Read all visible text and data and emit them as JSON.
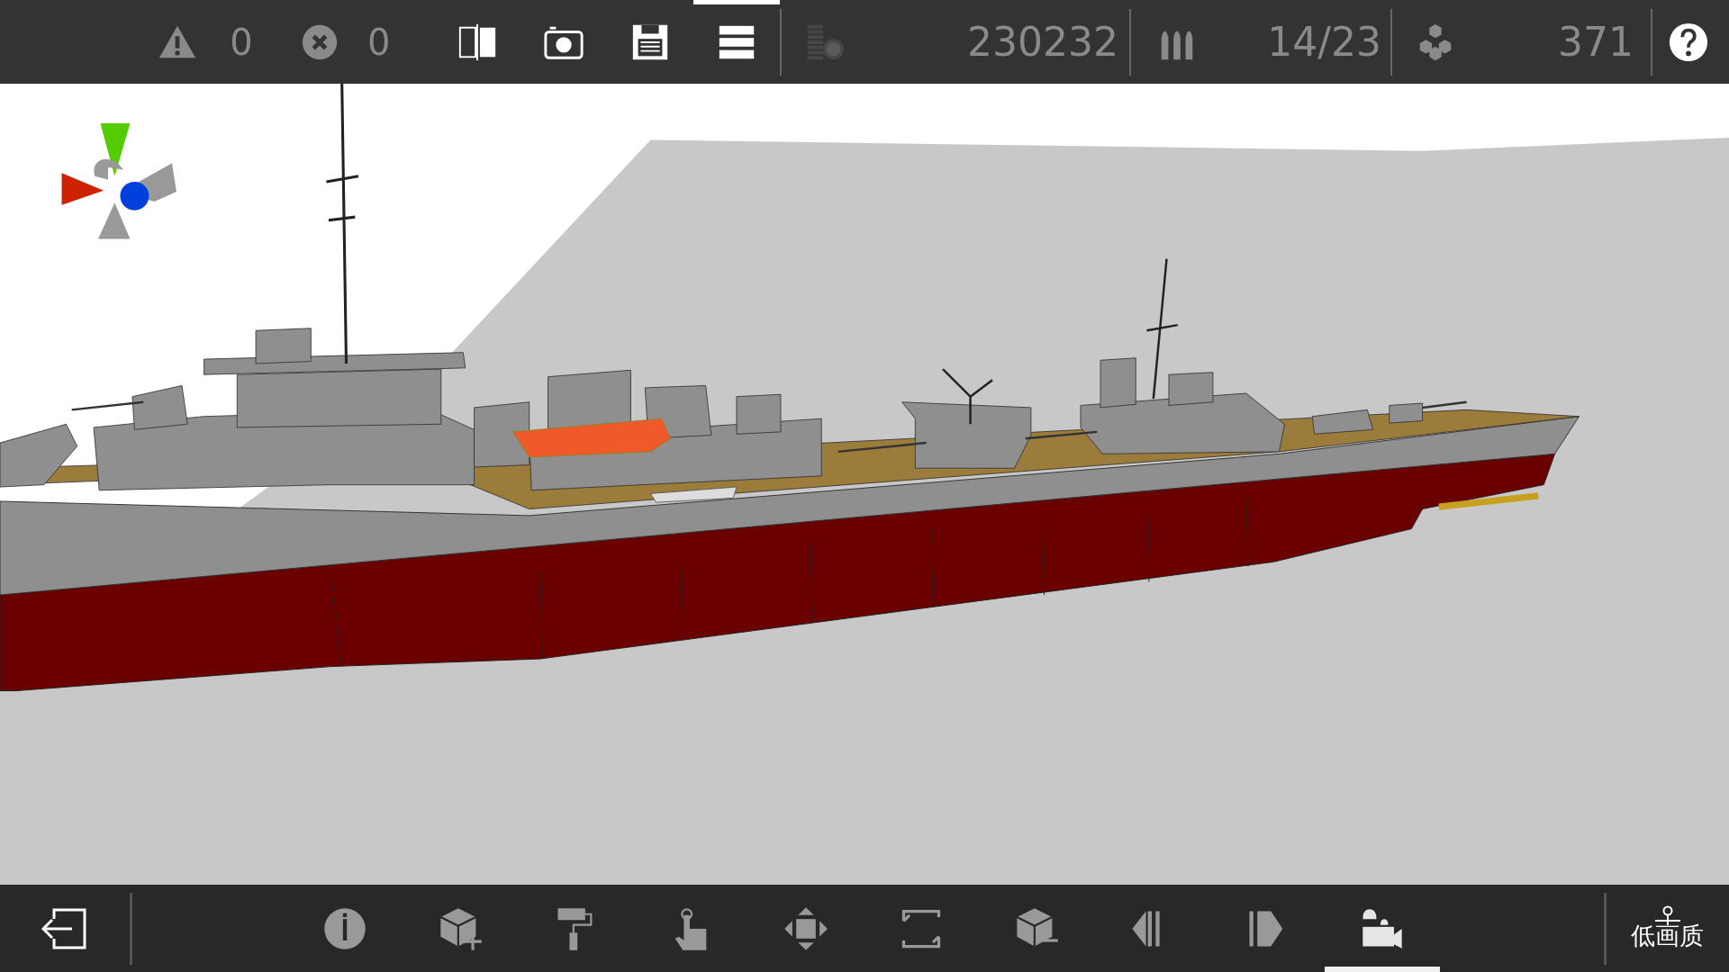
{
  "top_bar": {
    "indicators": [
      {
        "kind": "warning",
        "count": "0"
      },
      {
        "kind": "error",
        "count": "0"
      }
    ],
    "tools": [
      {
        "kind": "split-view",
        "selected": false,
        "disabled": false
      },
      {
        "kind": "camera",
        "selected": false,
        "disabled": false
      },
      {
        "kind": "save",
        "selected": false,
        "disabled": false
      },
      {
        "kind": "menu",
        "selected": true,
        "disabled": false
      },
      {
        "kind": "coins",
        "selected": false,
        "disabled": true
      }
    ],
    "stats": [
      {
        "kind": "cost",
        "value": "230232"
      },
      {
        "kind": "ammo",
        "value": "14/23"
      },
      {
        "kind": "parts",
        "value": "371"
      }
    ]
  },
  "bottom_bar": {
    "tools": [
      {
        "kind": "info",
        "selected": false
      },
      {
        "kind": "add-part",
        "selected": false
      },
      {
        "kind": "paint",
        "selected": false
      },
      {
        "kind": "select",
        "selected": false
      },
      {
        "kind": "move",
        "selected": false
      },
      {
        "kind": "resize",
        "selected": false
      },
      {
        "kind": "remove-part",
        "selected": false
      },
      {
        "kind": "previous",
        "selected": false
      },
      {
        "kind": "next",
        "selected": false
      },
      {
        "kind": "camera-view",
        "selected": true
      }
    ],
    "quality_toggle": {
      "label": "低画质"
    }
  }
}
